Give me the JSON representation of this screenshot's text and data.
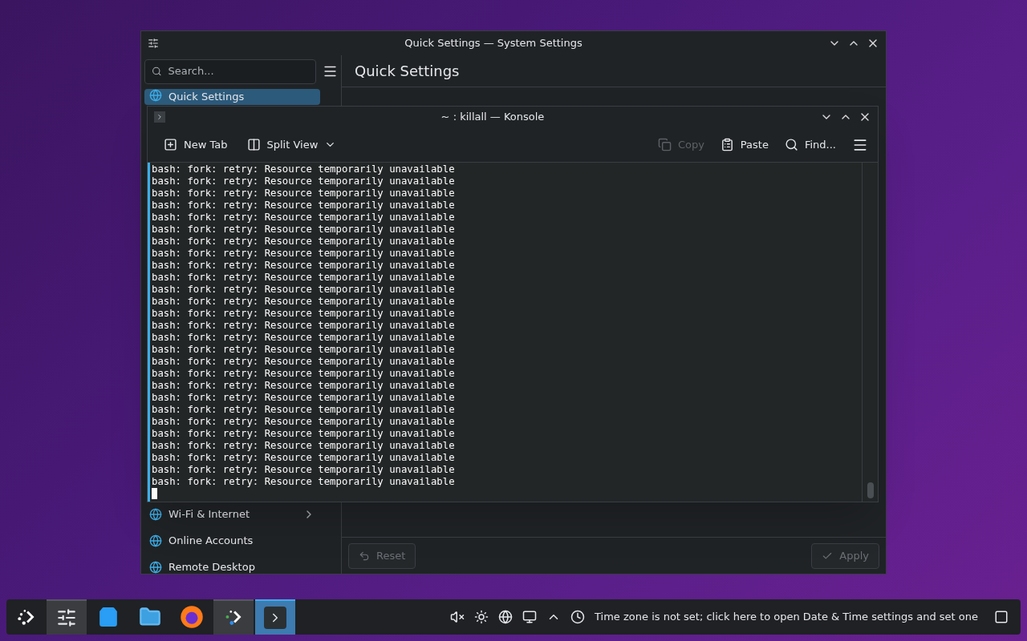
{
  "settings_window": {
    "title": "Quick Settings — System Settings",
    "search": {
      "placeholder": "Search..."
    },
    "page_title": "Quick Settings",
    "sidebar": {
      "items": [
        {
          "label": "Quick Settings",
          "selected": true,
          "has_children": false
        },
        {
          "label": "Wi-Fi & Internet",
          "selected": false,
          "has_children": true
        },
        {
          "label": "Online Accounts",
          "selected": false,
          "has_children": false
        },
        {
          "label": "Remote Desktop",
          "selected": false,
          "has_children": false
        }
      ]
    },
    "footer": {
      "buttons": [
        {
          "label": "Reset",
          "kind": "reset",
          "disabled": true
        },
        {
          "label": "Apply",
          "kind": "apply",
          "disabled": true
        }
      ]
    }
  },
  "konsole_window": {
    "title": "~ : killall — Konsole",
    "toolbar": [
      {
        "label": "New Tab",
        "kind": "new-tab",
        "disabled": false
      },
      {
        "label": "Split View",
        "kind": "split-view",
        "disabled": false
      }
    ],
    "toolbar_right": [
      {
        "label": "Copy",
        "kind": "copy",
        "disabled": true
      },
      {
        "label": "Paste",
        "kind": "paste",
        "disabled": false
      },
      {
        "label": "Find...",
        "kind": "find",
        "disabled": false
      }
    ],
    "output": [
      "bash: fork: retry: Resource temporarily unavailable",
      "bash: fork: retry: Resource temporarily unavailable",
      "bash: fork: retry: Resource temporarily unavailable",
      "bash: fork: retry: Resource temporarily unavailable",
      "bash: fork: retry: Resource temporarily unavailable",
      "bash: fork: retry: Resource temporarily unavailable",
      "bash: fork: retry: Resource temporarily unavailable",
      "bash: fork: retry: Resource temporarily unavailable",
      "bash: fork: retry: Resource temporarily unavailable",
      "bash: fork: retry: Resource temporarily unavailable",
      "bash: fork: retry: Resource temporarily unavailable",
      "bash: fork: retry: Resource temporarily unavailable",
      "bash: fork: retry: Resource temporarily unavailable",
      "bash: fork: retry: Resource temporarily unavailable",
      "bash: fork: retry: Resource temporarily unavailable",
      "bash: fork: retry: Resource temporarily unavailable",
      "bash: fork: retry: Resource temporarily unavailable",
      "bash: fork: retry: Resource temporarily unavailable",
      "bash: fork: retry: Resource temporarily unavailable",
      "bash: fork: retry: Resource temporarily unavailable",
      "bash: fork: retry: Resource temporarily unavailable",
      "bash: fork: retry: Resource temporarily unavailable",
      "bash: fork: retry: Resource temporarily unavailable",
      "bash: fork: retry: Resource temporarily unavailable",
      "bash: fork: retry: Resource temporarily unavailable",
      "bash: fork: retry: Resource temporarily unavailable",
      "bash: fork: retry: Resource temporarily unavailable"
    ]
  },
  "taskbar": {
    "tasks": [
      {
        "kind": "settings",
        "selected": false,
        "open": true
      },
      {
        "kind": "store",
        "selected": false,
        "open": false
      },
      {
        "kind": "files",
        "selected": false,
        "open": false
      },
      {
        "kind": "browser",
        "selected": false,
        "open": false
      },
      {
        "kind": "launcher",
        "selected": false,
        "open": true
      },
      {
        "kind": "terminal",
        "selected": true,
        "open": true
      }
    ],
    "notification": "Time zone is not set; click here to open Date & Time settings and set one"
  }
}
